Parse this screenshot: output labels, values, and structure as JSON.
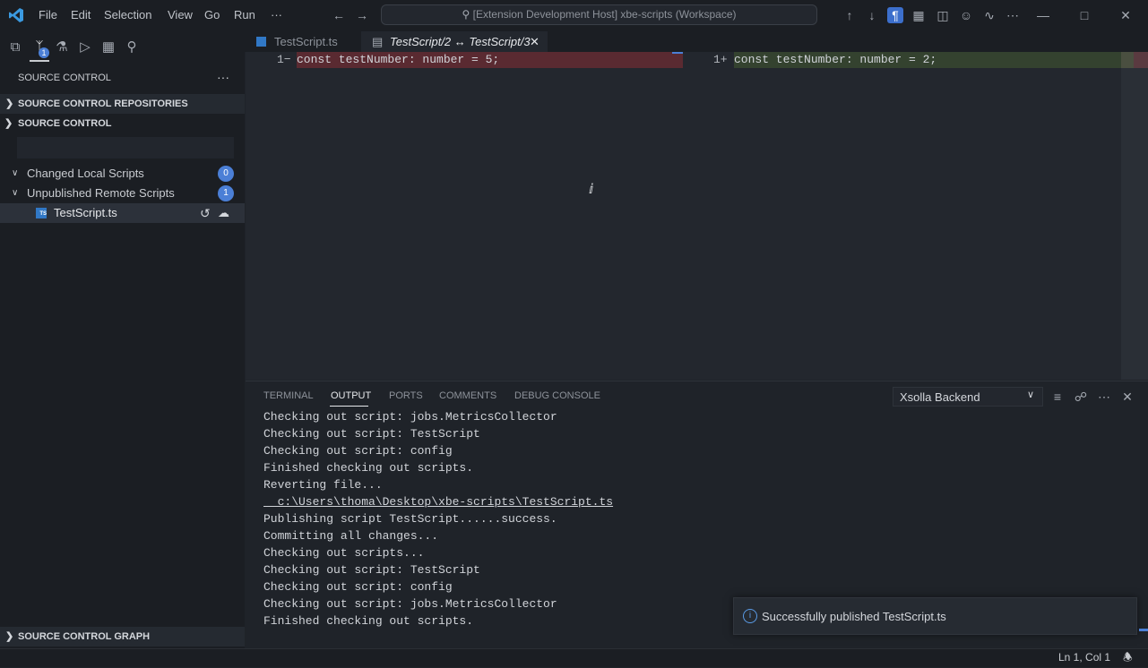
{
  "titlebar": {
    "menus": [
      "File",
      "Edit",
      "Selection",
      "View",
      "Go",
      "Run",
      "···"
    ],
    "command_center": "[Extension Development Host] xbe-scripts (Workspace)"
  },
  "activity": {
    "scm_badge": "1"
  },
  "sidebar": {
    "title": "SOURCE CONTROL",
    "more_glyph": "···",
    "repos_header": "SOURCE CONTROL REPOSITORIES",
    "scm_header": "SOURCE CONTROL",
    "groups": [
      {
        "label": "Changed Local Scripts",
        "count": "0"
      },
      {
        "label": "Unpublished Remote Scripts",
        "count": "1"
      }
    ],
    "file": {
      "name": "TestScript.ts",
      "icon_text": "TS"
    },
    "graph_header": "SOURCE CONTROL GRAPH"
  },
  "tabs": [
    {
      "label": "TestScript.ts",
      "active": false
    },
    {
      "label": "TestScript/2 ↔ TestScript/3",
      "active": true
    }
  ],
  "diff": {
    "left": {
      "gutter": "1−",
      "code": "const testNumber: number = 5;"
    },
    "right": {
      "gutter": "1+",
      "code": "const testNumber: number = 2;"
    }
  },
  "panel": {
    "tabs": [
      "TERMINAL",
      "OUTPUT",
      "PORTS",
      "COMMENTS",
      "DEBUG CONSOLE"
    ],
    "active_tab": "OUTPUT",
    "channel": "Xsolla Backend",
    "lines": [
      "Checking out script: jobs.MetricsCollector",
      "Checking out script: TestScript",
      "Checking out script: config",
      "Finished checking out scripts.",
      "Reverting file...",
      "  c:\\Users\\thoma\\Desktop\\xbe-scripts\\TestScript.ts",
      "Publishing script TestScript......success.",
      "Committing all changes...",
      "Checking out scripts...",
      "Checking out script: TestScript",
      "Checking out script: config",
      "Checking out script: jobs.MetricsCollector",
      "Finished checking out scripts."
    ]
  },
  "notification": {
    "message": "Successfully published TestScript.ts"
  },
  "status": {
    "position": "Ln 1, Col 1"
  },
  "colors": {
    "accent": "#4b7fd6",
    "deleted_bg": "#5a2a31",
    "added_bg": "#34422f"
  }
}
